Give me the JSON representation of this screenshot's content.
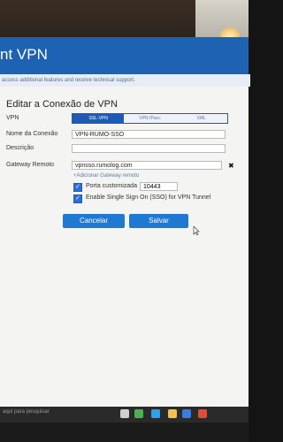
{
  "header": {
    "title": "nt VPN",
    "notice": "access additional features and receive technical support."
  },
  "form": {
    "section_title": "Editar a Conexão de VPN",
    "vpn_label": "VPN",
    "tabs": [
      {
        "label": "SSL-VPN",
        "active": true
      },
      {
        "label": "VPN IPsec",
        "active": false
      },
      {
        "label": "XML",
        "active": false
      }
    ],
    "connection_name_label": "Nome da Conexão",
    "connection_name_value": "VPN-RUMO-SSO",
    "description_label": "Descrição",
    "description_value": "",
    "remote_gateway_label": "Gateway Remoto",
    "remote_gateway_value": "vpnsso.rumolog.com",
    "add_gateway_link": "+Adicionar Gateway remoto",
    "custom_port_label": "Porta customizada",
    "custom_port_checked": true,
    "custom_port_value": "10443",
    "sso_label": "Enable Single Sign On (SSO) for VPN Tunnel",
    "sso_checked": true,
    "cancel_label": "Cancelar",
    "save_label": "Salvar"
  },
  "taskbar": {
    "search_text": "aqui para pesquisar",
    "icons": [
      {
        "name": "task-view-icon",
        "color": "#cfcfcf"
      },
      {
        "name": "chrome-icon",
        "color": "#4caf50"
      },
      {
        "name": "edge-icon",
        "color": "#2ba3e8"
      },
      {
        "name": "file-explorer-icon",
        "color": "#f2c14e"
      },
      {
        "name": "store-icon",
        "color": "#3b7ae0"
      },
      {
        "name": "mail-icon",
        "color": "#e14b3b"
      }
    ]
  },
  "colors": {
    "header_blue": "#1e62b3",
    "button_blue": "#1f78d1",
    "checkbox_blue": "#2b6fd6"
  }
}
